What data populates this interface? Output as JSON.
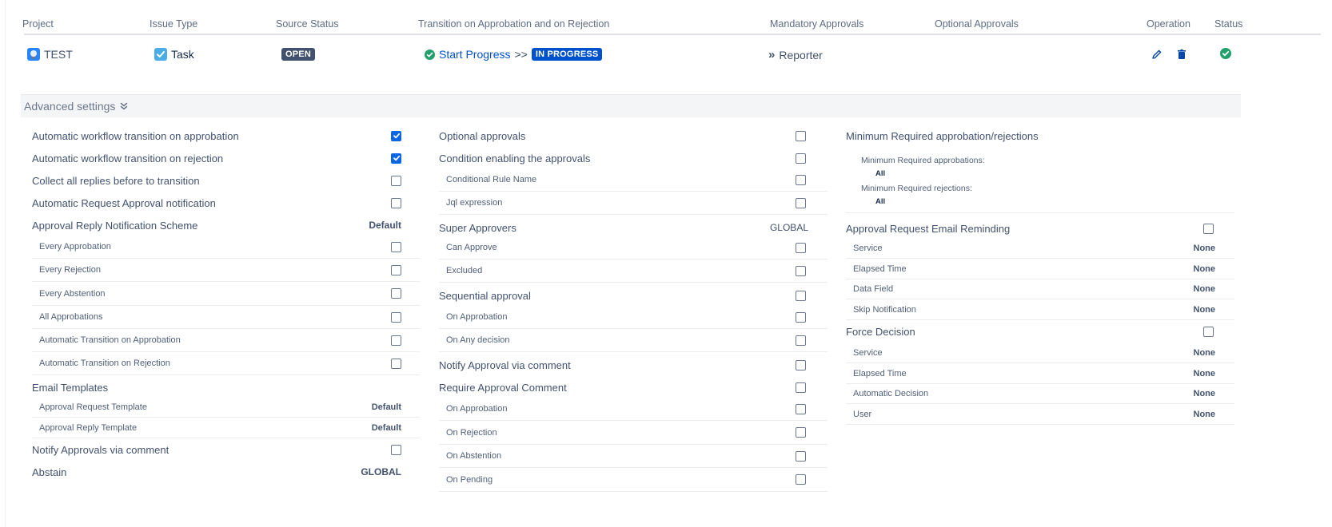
{
  "table": {
    "headers": {
      "project": "Project",
      "issue_type": "Issue Type",
      "source_status": "Source Status",
      "transition": "Transition on Approbation and on Rejection",
      "mandatory": "Mandatory Approvals",
      "optional": "Optional Approvals",
      "operation": "Operation",
      "status": "Status"
    },
    "row": {
      "project": "TEST",
      "issue_type": "Task",
      "source_status": "OPEN",
      "transition_name": "Start Progress",
      "transition_arrow": ">>",
      "target_status": "IN PROGRESS",
      "mandatory_prefix": "»",
      "mandatory": "Reporter",
      "optional": ""
    }
  },
  "advanced": {
    "label": "Advanced settings"
  },
  "col1": {
    "auto_approb": {
      "label": "Automatic workflow transition on approbation",
      "checked": true
    },
    "auto_reject": {
      "label": "Automatic workflow transition on rejection",
      "checked": true
    },
    "collect": {
      "label": "Collect all replies before to transition",
      "checked": false
    },
    "auto_req": {
      "label": "Automatic Request Approval notification",
      "checked": false
    },
    "scheme": {
      "label": "Approval Reply Notification Scheme",
      "value": "Default"
    },
    "every_approb": {
      "label": "Every Approbation",
      "checked": false
    },
    "every_reject": {
      "label": "Every Rejection",
      "checked": false
    },
    "every_abst": {
      "label": "Every Abstention",
      "checked": false
    },
    "all_approb": {
      "label": "All Approbations",
      "checked": false
    },
    "at_approb": {
      "label": "Automatic Transition on Approbation",
      "checked": false
    },
    "at_reject": {
      "label": "Automatic Transition on Rejection",
      "checked": false
    },
    "email_templates": {
      "label": "Email Templates"
    },
    "req_tmpl": {
      "label": "Approval Request Template",
      "value": "Default"
    },
    "reply_tmpl": {
      "label": "Approval Reply Template",
      "value": "Default"
    },
    "notify_comment": {
      "label": "Notify Approvals via comment",
      "checked": false
    },
    "abstain": {
      "label": "Abstain",
      "value": "GLOBAL"
    }
  },
  "col2": {
    "optional": {
      "label": "Optional approvals",
      "checked": false
    },
    "condition": {
      "label": "Condition enabling the approvals",
      "checked": false
    },
    "rule_name": {
      "label": "Conditional Rule Name",
      "checked": false
    },
    "jql": {
      "label": "Jql expression",
      "checked": false
    },
    "super": {
      "label": "Super Approvers",
      "value": "GLOBAL"
    },
    "can_approve": {
      "label": "Can Approve",
      "checked": false
    },
    "excluded": {
      "label": "Excluded",
      "checked": false
    },
    "sequential": {
      "label": "Sequential approval",
      "checked": false
    },
    "seq_approb": {
      "label": "On Approbation",
      "checked": false
    },
    "seq_any": {
      "label": "On Any decision",
      "checked": false
    },
    "notify_comment": {
      "label": "Notify Approval via comment",
      "checked": false
    },
    "require_comment": {
      "label": "Require Approval Comment",
      "checked": false
    },
    "rc_approb": {
      "label": "On Approbation",
      "checked": false
    },
    "rc_reject": {
      "label": "On Rejection",
      "checked": false
    },
    "rc_abst": {
      "label": "On Abstention",
      "checked": false
    },
    "rc_pending": {
      "label": "On Pending",
      "checked": false
    }
  },
  "col3": {
    "min_req": {
      "label": "Minimum Required approbation/rejections"
    },
    "min_approb": {
      "label": "Minimum Required approbations:",
      "value": "All"
    },
    "min_reject": {
      "label": "Minimum Required rejections:",
      "value": "All"
    },
    "remind": {
      "label": "Approval Request Email Reminding",
      "checked": false
    },
    "r_service": {
      "label": "Service",
      "value": "None"
    },
    "r_elapsed": {
      "label": "Elapsed Time",
      "value": "None"
    },
    "r_datafield": {
      "label": "Data Field",
      "value": "None"
    },
    "r_skip": {
      "label": "Skip Notification",
      "value": "None"
    },
    "force": {
      "label": "Force Decision",
      "checked": false
    },
    "f_service": {
      "label": "Service",
      "value": "None"
    },
    "f_elapsed": {
      "label": "Elapsed Time",
      "value": "None"
    },
    "f_auto": {
      "label": "Automatic Decision",
      "value": "None"
    },
    "f_user": {
      "label": "User",
      "value": "None"
    }
  },
  "colors": {
    "link": "#0052cc",
    "open_lozenge": "#42526e",
    "progress_lozenge": "#0052cc",
    "check_on": "#0c66e4",
    "success": "#22a06b"
  },
  "icons": {
    "project": "project-avatar-icon",
    "task": "task-checkbox-icon",
    "transition": "check-circle-icon",
    "expand": "chevron-double-down-icon",
    "edit": "pencil-icon",
    "delete": "trash-icon",
    "status": "check-circle-icon"
  }
}
